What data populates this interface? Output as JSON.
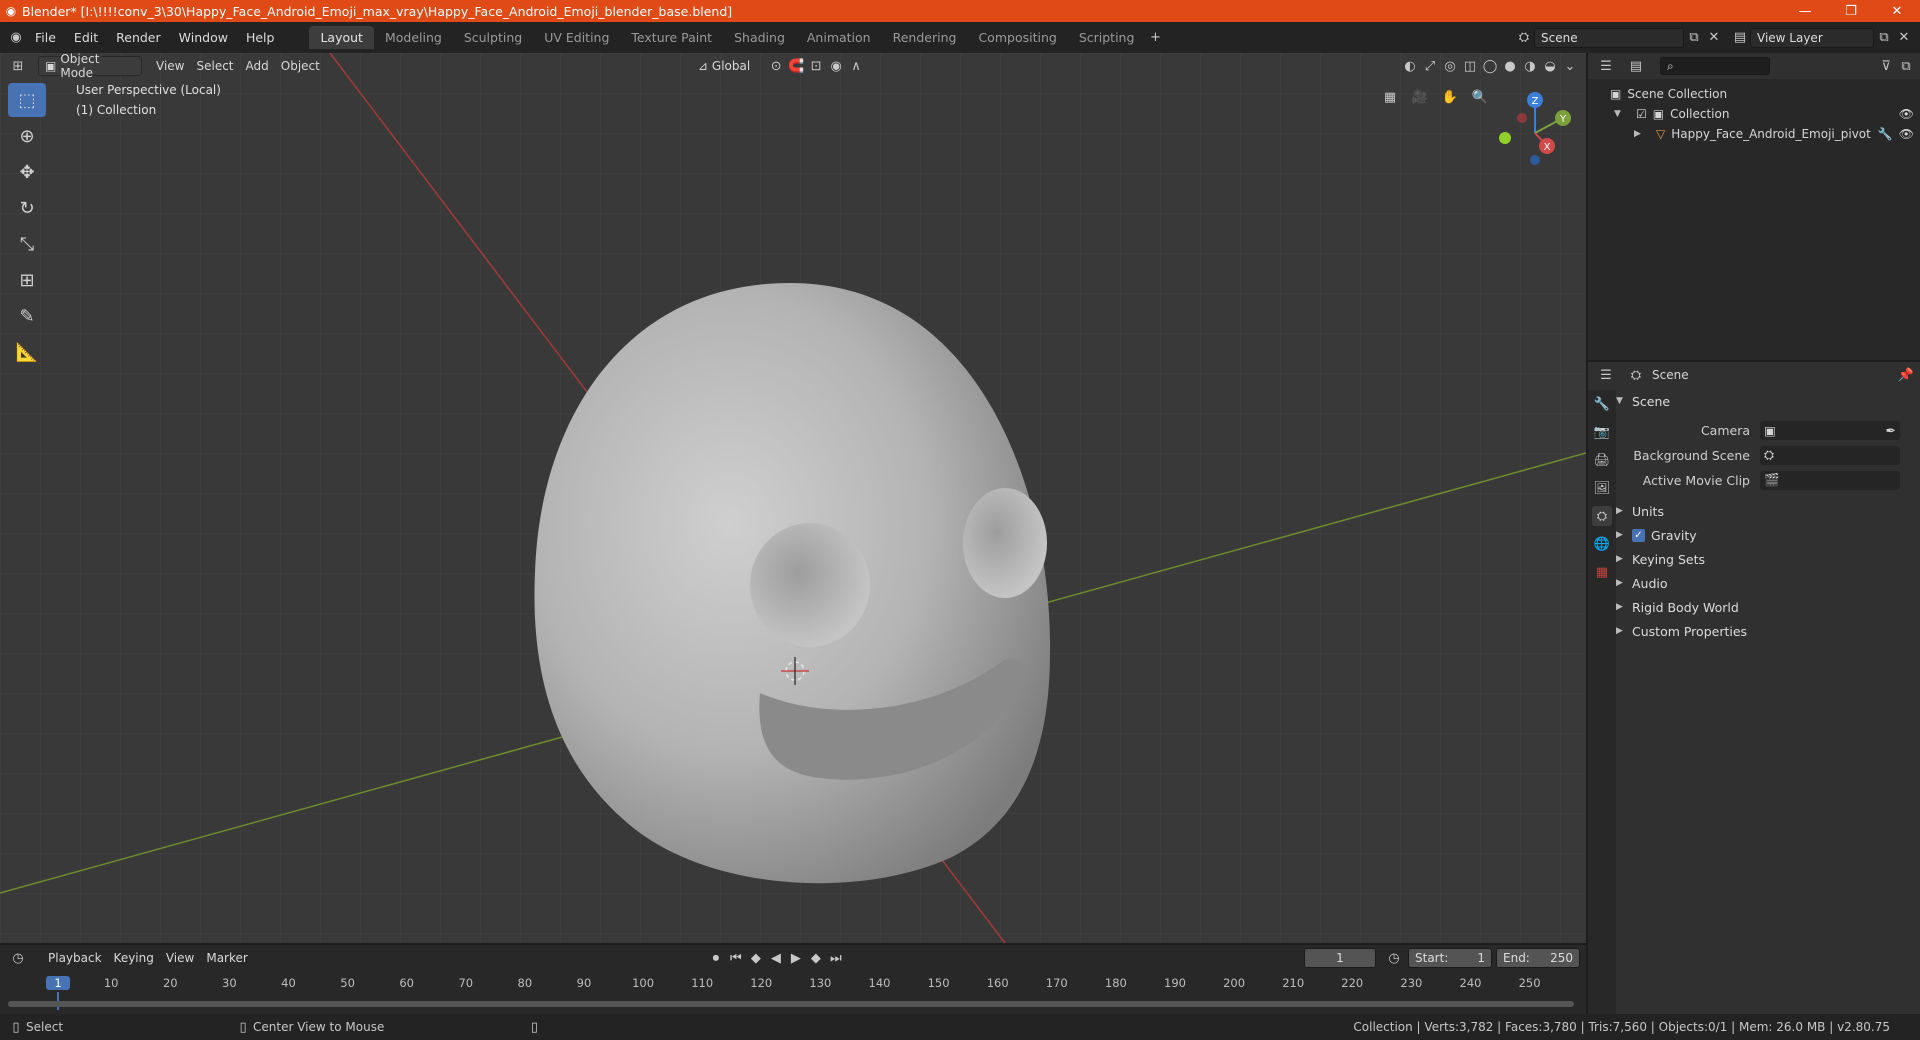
{
  "window": {
    "title": "Blender* [I:\\!!!!conv_3\\30\\Happy_Face_Android_Emoji_max_vray\\Happy_Face_Android_Emoji_blender_base.blend]",
    "minimize": "—",
    "maximize": "❐",
    "close": "✕"
  },
  "menu": [
    "File",
    "Edit",
    "Render",
    "Window",
    "Help"
  ],
  "workspaces": [
    "Layout",
    "Modeling",
    "Sculpting",
    "UV Editing",
    "Texture Paint",
    "Shading",
    "Animation",
    "Rendering",
    "Compositing",
    "Scripting"
  ],
  "scene_selector": {
    "value": "Scene"
  },
  "view_layer_selector": {
    "value": "View Layer"
  },
  "viewport_header": {
    "mode": "Object Mode",
    "menus": [
      "View",
      "Select",
      "Add",
      "Object"
    ],
    "orientation": "Global"
  },
  "viewport": {
    "perspective_label": "User Perspective (Local)",
    "collection_label": "(1) Collection",
    "gizmo": {
      "x": "X",
      "y": "Y",
      "z": "Z"
    }
  },
  "outliner": {
    "search_placeholder": "",
    "scene_collection": "Scene Collection",
    "collection": "Collection",
    "object": "Happy_Face_Android_Emoji_pivot"
  },
  "properties": {
    "context": "Scene",
    "panel_title": "Scene",
    "camera_label": "Camera",
    "background_scene_label": "Background Scene",
    "active_movie_clip_label": "Active Movie Clip",
    "panels": [
      "Units",
      "Gravity",
      "Keying Sets",
      "Audio",
      "Rigid Body World",
      "Custom Properties"
    ],
    "gravity_checked": true
  },
  "timeline": {
    "menus": [
      "Playback",
      "Keying",
      "View",
      "Marker"
    ],
    "current_frame": "1",
    "start_label": "Start:",
    "start_value": "1",
    "end_label": "End:",
    "end_value": "250",
    "ruler": [
      "1",
      "10",
      "20",
      "30",
      "40",
      "50",
      "60",
      "70",
      "80",
      "90",
      "100",
      "110",
      "120",
      "130",
      "140",
      "150",
      "160",
      "170",
      "180",
      "190",
      "200",
      "210",
      "220",
      "230",
      "240",
      "250"
    ]
  },
  "statusbar": {
    "left_action": "Select",
    "middle_action": "Center View to Mouse",
    "stats": "Collection | Verts:3,782 | Faces:3,780 | Tris:7,560 | Objects:0/1 | Mem: 26.0 MB | v2.80.75"
  },
  "colors": {
    "accent": "#4772b3",
    "titlebar": "#e04a16",
    "x_axis": "#c0392b",
    "y_axis": "#7aa13a"
  }
}
